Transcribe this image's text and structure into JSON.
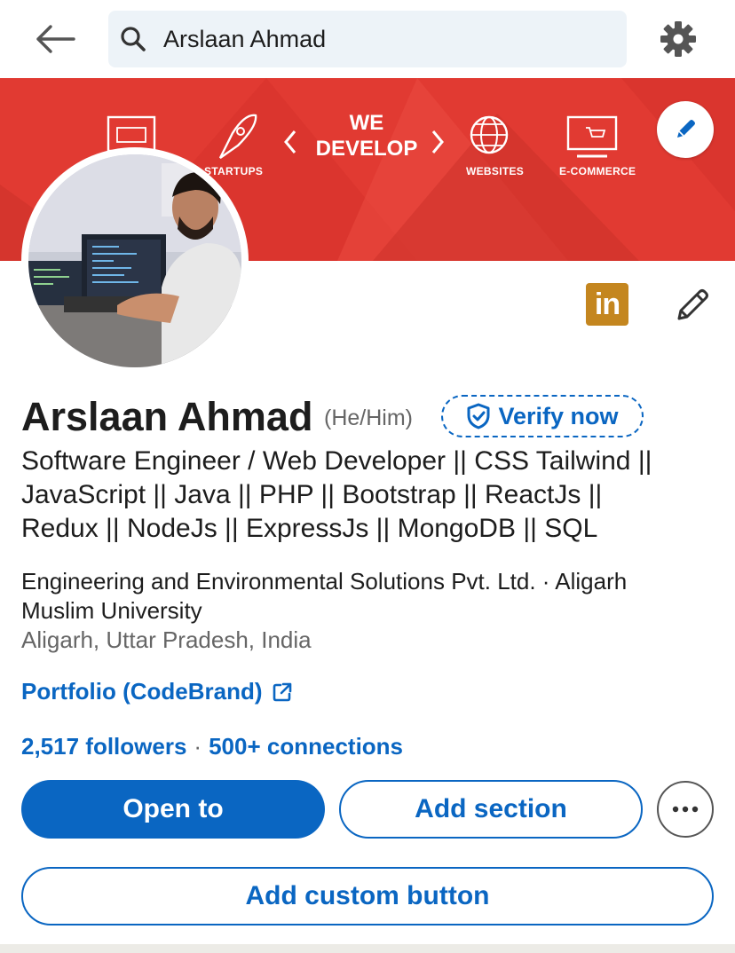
{
  "search": {
    "query": "Arslaan Ahmad"
  },
  "banner": {
    "headline_line1": "WE",
    "headline_line2": "DEVELOP",
    "labels": [
      "STARTUPS",
      "WEBSITES",
      "E-COMMERCE"
    ]
  },
  "profile": {
    "name": "Arslaan Ahmad",
    "pronouns": "(He/Him)",
    "verify_label": "Verify now",
    "headline_lines": [
      "Software Engineer / Web Developer || CSS Tailwind ||",
      "JavaScript || Java || PHP || Bootstrap || ReactJs ||",
      "Redux || NodeJs  || ExpressJs || MongoDB || SQL"
    ],
    "experience_lines": [
      "Engineering and Environmental Solutions Pvt. Ltd. · Aligarh",
      "Muslim University"
    ],
    "location": "Aligarh, Uttar Pradesh, India",
    "website_label": "Portfolio (CodeBrand)",
    "followers": "2,517 followers",
    "separator": "·",
    "connections": "500+ connections"
  },
  "linkedin_badge": "in",
  "buttons": {
    "open_to": "Open to",
    "add_section": "Add section",
    "add_custom": "Add custom button"
  },
  "colors": {
    "accent": "#0a66c2",
    "banner_red": "#e13a32",
    "linkedin_gold": "#c4861f",
    "search_bg": "#edf3f8"
  }
}
